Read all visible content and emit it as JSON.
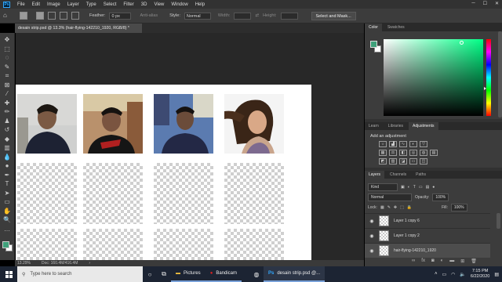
{
  "menu": {
    "logo": "Ps",
    "items": [
      "File",
      "Edit",
      "Image",
      "Layer",
      "Type",
      "Select",
      "Filter",
      "3D",
      "View",
      "Window",
      "Help"
    ]
  },
  "options": {
    "feather_label": "Feather:",
    "feather_value": "0 px",
    "antialias_label": "Anti-alias",
    "style_label": "Style:",
    "style_value": "Normal",
    "width_label": "Width:",
    "height_label": "Height:",
    "select_mask_label": "Select and Mask..."
  },
  "document": {
    "tab_title": "desain strip.psd @ 13.3% (hair-flying-142210_1920, RGB/8) *"
  },
  "status": {
    "zoom": "13.29%",
    "doc_size": "Doc: 160.4M/416.4M"
  },
  "panels": {
    "top_tabs": [
      "Color",
      "Swatches"
    ],
    "mid_tabs": [
      "Learn",
      "Libraries",
      "Adjustments"
    ],
    "adjustments_title": "Add an adjustment",
    "layer_tabs": [
      "Layers",
      "Channels",
      "Paths"
    ],
    "kind_label": "Kind",
    "blend_mode": "Normal",
    "opacity_label": "Opacity:",
    "opacity_value": "100%",
    "lock_label": "Lock:",
    "fill_label": "Fill:",
    "fill_value": "100%",
    "layers": [
      {
        "name": "Layer 1 copy 6"
      },
      {
        "name": "Layer 1 copy 2"
      },
      {
        "name": "hair-flying-142210_1920"
      }
    ]
  },
  "colors": {
    "foreground": "#3fa07a",
    "background": "#ffffff"
  },
  "taskbar": {
    "search_placeholder": "Type here to search",
    "apps": [
      "Pictures",
      "Bandicam",
      "desain strip.psd @..."
    ],
    "time": "7:15 PM",
    "date": "6/22/2020"
  }
}
